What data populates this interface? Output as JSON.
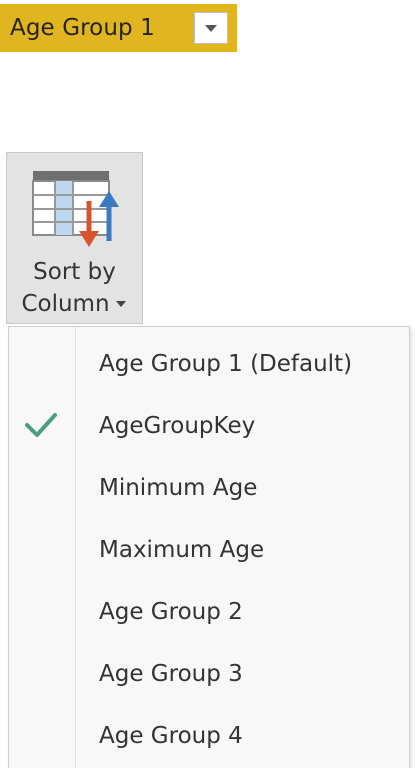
{
  "field_chip": {
    "label": "Age Group 1",
    "accent_color": "#e1b51f",
    "dropdown_icon": "chevron-down-icon"
  },
  "ribbon_button": {
    "label_line1": "Sort by",
    "label_line2": "Column",
    "icon": "sort-by-column-icon",
    "caret_icon": "caret-down-icon"
  },
  "menu": {
    "items": [
      {
        "label": "Age Group 1 (Default)",
        "checked": false
      },
      {
        "label": "AgeGroupKey",
        "checked": true
      },
      {
        "label": "Minimum Age",
        "checked": false
      },
      {
        "label": "Maximum Age",
        "checked": false
      },
      {
        "label": "Age Group 2",
        "checked": false
      },
      {
        "label": "Age Group 3",
        "checked": false
      },
      {
        "label": "Age Group 4",
        "checked": false
      }
    ],
    "check_icon": "checkmark-icon",
    "check_color": "#4a9e84"
  }
}
